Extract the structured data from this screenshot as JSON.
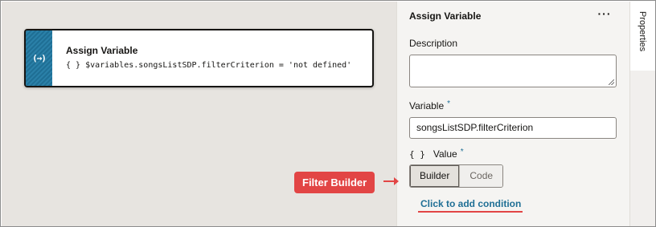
{
  "canvas": {
    "node": {
      "icon": "(→)",
      "title": "Assign Variable",
      "brace": "{ }",
      "expression": "$variables.songsListSDP.filterCriterion = 'not defined'"
    }
  },
  "panel": {
    "title": "Assign Variable",
    "more_icon": "···",
    "description_label": "Description",
    "description_value": "",
    "variable_label": "Variable",
    "variable_required": "*",
    "variable_value": "songsListSDP.filterCriterion",
    "value_brace": "{ }",
    "value_label": "Value",
    "value_required": "*",
    "mode_options": [
      "Builder",
      "Code"
    ],
    "mode_selected": "Builder",
    "add_condition_link": "Click to add condition"
  },
  "rail": {
    "tab_label": "Properties"
  },
  "annotation": {
    "callout_text": "Filter Builder",
    "accent_color": "#e24545"
  },
  "colors": {
    "node_strip": "#1f6f95",
    "link": "#1f6f95",
    "canvas_bg": "#e7e4e0"
  }
}
